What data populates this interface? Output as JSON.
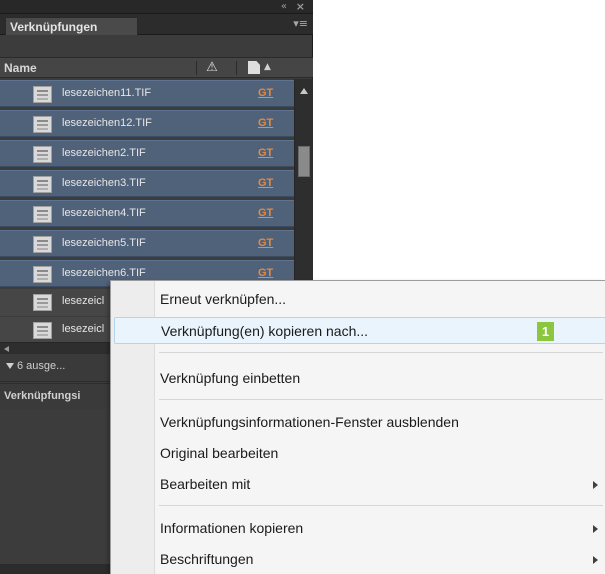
{
  "panel": {
    "collapse_glyph": "«",
    "close_glyph": "×",
    "tab_title": "Verknüpfungen",
    "menu_glyph": "▾≡",
    "columns": {
      "name": "Name",
      "warning_glyph": "⚠",
      "sort_glyph": "▲"
    },
    "rows": [
      {
        "name": "lesezeichen11.TIF",
        "status": "GT",
        "selected": true
      },
      {
        "name": "lesezeichen12.TIF",
        "status": "GT",
        "selected": true
      },
      {
        "name": "lesezeichen2.TIF",
        "status": "GT",
        "selected": true
      },
      {
        "name": "lesezeichen3.TIF",
        "status": "GT",
        "selected": true
      },
      {
        "name": "lesezeichen4.TIF",
        "status": "GT",
        "selected": true
      },
      {
        "name": "lesezeichen5.TIF",
        "status": "GT",
        "selected": true
      },
      {
        "name": "lesezeichen6.TIF",
        "status": "GT",
        "selected": true
      },
      {
        "name": "lesezeicl",
        "status": "",
        "selected": false
      },
      {
        "name": "lesezeicl",
        "status": "",
        "selected": false
      }
    ],
    "selection_summary": "6 ausge...",
    "info_section": "Verknüpfungsi"
  },
  "context_menu": {
    "items": [
      {
        "label": "Erneut verknüpfen...",
        "submenu": false,
        "highlighted": false
      },
      {
        "label": "Verknüpfung(en) kopieren nach...",
        "submenu": false,
        "highlighted": true
      },
      {
        "label": "Verknüpfung einbetten",
        "submenu": false,
        "highlighted": false
      },
      {
        "label": "Verknüpfungsinformationen-Fenster ausblenden",
        "submenu": false,
        "highlighted": false
      },
      {
        "label": "Original bearbeiten",
        "submenu": false,
        "highlighted": false
      },
      {
        "label": "Bearbeiten mit",
        "submenu": true,
        "highlighted": false
      },
      {
        "label": "Informationen kopieren",
        "submenu": true,
        "highlighted": false
      },
      {
        "label": "Beschriftungen",
        "submenu": true,
        "highlighted": false
      }
    ],
    "step_badge": "1"
  },
  "colors": {
    "selected_row": "#50627a",
    "status_text": "#e38b3f",
    "badge": "#8cc63f",
    "menu_highlight": "#eaf4fc"
  }
}
